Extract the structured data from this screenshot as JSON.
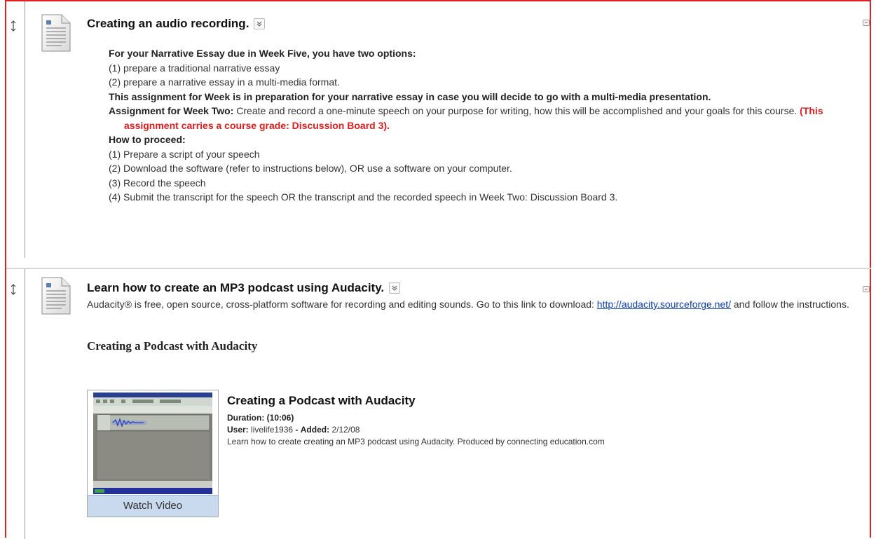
{
  "items": [
    {
      "title": "Creating an audio recording.",
      "lines": [
        {
          "kind": "bold",
          "text": "For your Narrative Essay due in Week Five, you have two options:"
        },
        {
          "kind": "normal",
          "text": "(1) prepare a traditional narrative essay"
        },
        {
          "kind": "normal",
          "text": "(2) prepare a narrative essay in a multi-media format."
        },
        {
          "kind": "bold",
          "text": "This assignment for Week is in preparation for your narrative essay in case you will decide to go with a multi-media presentation."
        },
        {
          "kind": "assignment",
          "label": "Assignment for Week Two:",
          "text": " Create and record a one-minute speech on your purpose for writing, how this will be accomplished and your goals for this course. ",
          "highlight": "(This assignment carries a course grade: Discussion Board 3)."
        },
        {
          "kind": "bold",
          "text": "How to proceed:"
        },
        {
          "kind": "normal",
          "text": "(1) Prepare a script of your speech"
        },
        {
          "kind": "normal",
          "text": "(2) Download the software (refer to instructions below), OR use a software on your computer."
        },
        {
          "kind": "normal",
          "text": "(3) Record the speech"
        },
        {
          "kind": "normal",
          "text": "(4) Submit the transcript for the speech OR the transcript and the recorded speech in Week Two: Discussion Board 3."
        }
      ]
    },
    {
      "title": "Learn how to create an MP3 podcast using Audacity.",
      "intro_text": "Audacity® is free, open source, cross-platform software for recording and editing sounds.  Go to this link to download: ",
      "link_text": "http://audacity.sourceforge.net/",
      "intro_tail": " and follow the instructions.",
      "subheading": "Creating a Podcast with Audacity",
      "video": {
        "title": "Creating a Podcast with Audacity",
        "duration_label": "Duration:",
        "duration": "(10:06)",
        "user_label": "User:",
        "user": "livelife1936",
        "added_label": "Added:",
        "added": "2/12/08",
        "description": "Learn how to create creating an MP3 podcast using Audacity. Produced by connecting education.com",
        "watch_label": "Watch Video"
      }
    }
  ],
  "colors": {
    "frame": "#e21f26",
    "highlight": "#e31b1b",
    "link": "#0b3fb8"
  },
  "icons": [
    "drag-handle-icon",
    "document-icon",
    "menu-chevron-icon",
    "collapse-icon"
  ]
}
